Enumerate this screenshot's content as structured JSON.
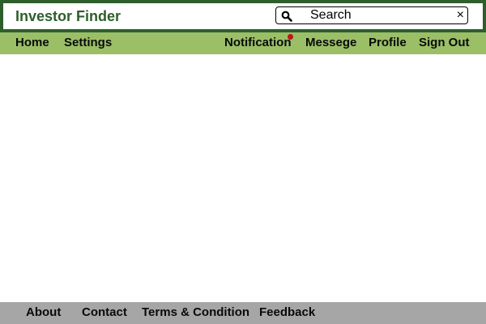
{
  "header": {
    "app_title": "Investor Finder",
    "search": {
      "placeholder": "Search",
      "value": "",
      "clear_icon": "×"
    }
  },
  "nav": {
    "left": [
      "Home",
      "Settings"
    ],
    "right": [
      "Notification",
      "Messege",
      "Profile",
      "Sign Out"
    ]
  },
  "notification": {
    "dot_color": "#c0141a",
    "has_unread": true
  },
  "footer": {
    "links": [
      "About",
      "Contact",
      "Terms & Condition",
      "Feedback"
    ]
  },
  "colors": {
    "header_border": "#2e5e2c",
    "title_text": "#2e5e2c",
    "navbar_bg": "#9abf67",
    "footer_bg": "#a6a6a6"
  },
  "icons": {
    "search": "search-icon",
    "clear": "close-icon"
  }
}
